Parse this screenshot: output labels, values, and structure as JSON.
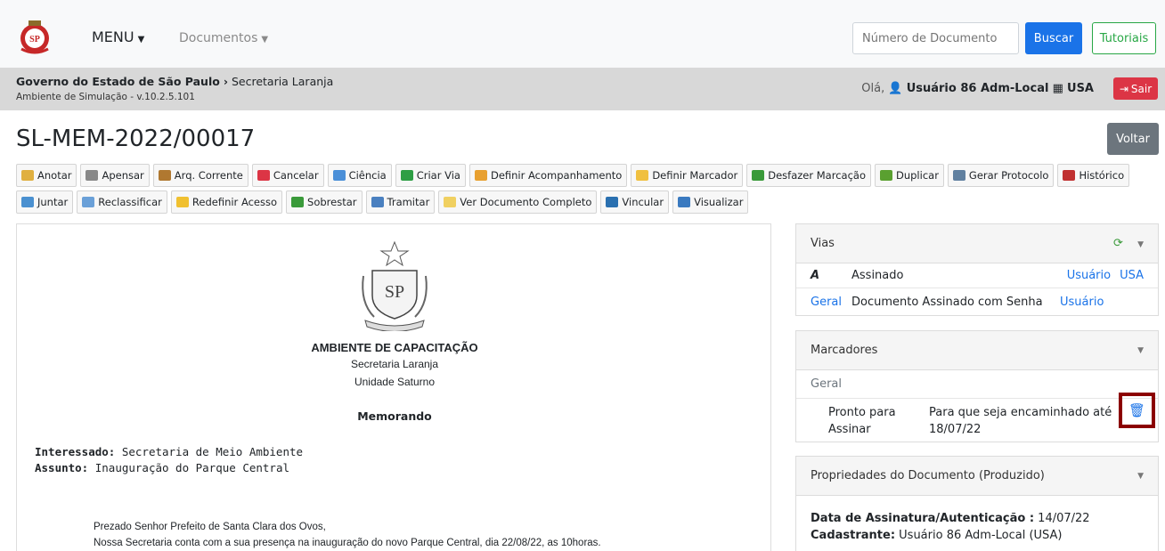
{
  "navbar": {
    "menu_label": "MENU",
    "documents_label": "Documentos",
    "search_placeholder": "Número de Documento",
    "search_button": "Buscar",
    "tutorials_button": "Tutoriais"
  },
  "subbar": {
    "org": "Governo do Estado de São Paulo",
    "separator": "›",
    "secretaria": "Secretaria Laranja",
    "environment": "Ambiente de Simulação - v.10.2.5.101",
    "greeting_prefix": "Olá,",
    "user": "Usuário 86 Adm-Local",
    "unit": "USA",
    "logout_button": "Sair"
  },
  "document": {
    "title": "SL-MEM-2022/00017",
    "back_button": "Voltar"
  },
  "toolbar": {
    "row1": [
      {
        "label": "Anotar",
        "color": "#e0b040"
      },
      {
        "label": "Apensar",
        "color": "#888888"
      },
      {
        "label": "Arq. Corrente",
        "color": "#b07830"
      },
      {
        "label": "Cancelar",
        "color": "#dc3545"
      },
      {
        "label": "Ciência",
        "color": "#4a8fd8"
      },
      {
        "label": "Criar Via",
        "color": "#2e9e44"
      },
      {
        "label": "Definir Acompanhamento",
        "color": "#e8a030"
      },
      {
        "label": "Definir Marcador",
        "color": "#f0c040"
      },
      {
        "label": "Desfazer Marcação",
        "color": "#3a9a3a"
      },
      {
        "label": "Duplicar",
        "color": "#5aa030"
      },
      {
        "label": "Gerar Protocolo",
        "color": "#6080a0"
      },
      {
        "label": "Histórico",
        "color": "#c03030"
      }
    ],
    "row2": [
      {
        "label": "Juntar",
        "color": "#4a90d0"
      },
      {
        "label": "Reclassificar",
        "color": "#6aa0d8"
      },
      {
        "label": "Redefinir Acesso",
        "color": "#f0c030"
      },
      {
        "label": "Sobrestar",
        "color": "#3a9a3a"
      },
      {
        "label": "Tramitar",
        "color": "#4a80c0"
      },
      {
        "label": "Ver Documento Completo",
        "color": "#f0d060"
      },
      {
        "label": "Vincular",
        "color": "#2a70b0"
      },
      {
        "label": "Visualizar",
        "color": "#3a7ac0"
      }
    ]
  },
  "doc_content": {
    "ambiente": "AMBIENTE DE CAPACITAÇÃO",
    "secretaria": "Secretaria Laranja",
    "unidade": "Unidade Saturno",
    "doc_type": "Memorando",
    "interessado_label": "Interessado:",
    "interessado_value": "Secretaria de Meio Ambiente",
    "assunto_label": "Assunto:",
    "assunto_value": "Inauguração do Parque Central",
    "salutation": "Prezado Senhor Prefeito de Santa Clara dos Ovos,",
    "body": "Nossa Secretaria conta com a sua presença na inauguração do novo Parque Central, dia 22/08/22, as 10horas."
  },
  "vias": {
    "title": "Vias",
    "row1": {
      "via": "A",
      "status": "Assinado",
      "user": "Usuário",
      "unit": "USA"
    },
    "row2": {
      "scope": "Geral",
      "status": "Documento Assinado com Senha",
      "user": "Usuário"
    }
  },
  "marcadores": {
    "title": "Marcadores",
    "group": "Geral",
    "item_name": "Pronto para Assinar",
    "item_desc": "Para que seja encaminhado até 18/07/22"
  },
  "propriedades": {
    "title": "Propriedades do Documento (Produzido)",
    "data_label": "Data de Assinatura/Autenticação :",
    "data_value": "14/07/22",
    "cadastrante_label": "Cadastrante:",
    "cadastrante_value": "Usuário 86 Adm-Local (USA)"
  }
}
